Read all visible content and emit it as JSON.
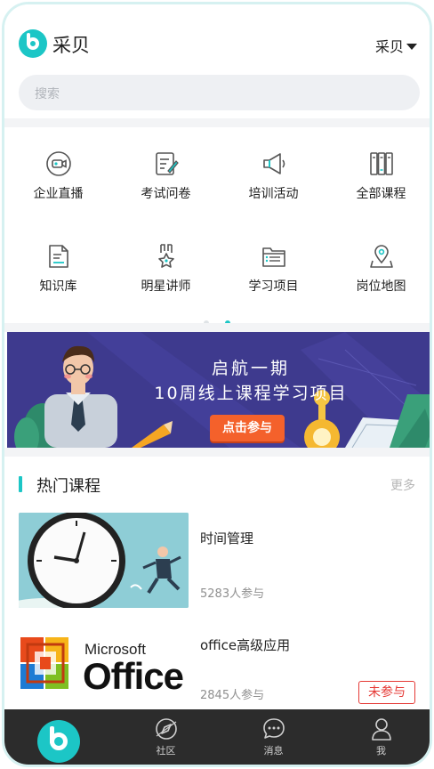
{
  "header": {
    "app_title": "采贝",
    "location": "采贝"
  },
  "search": {
    "placeholder": "搜索"
  },
  "grid": [
    {
      "label": "企业直播",
      "icon": "live-camera-icon"
    },
    {
      "label": "考试问卷",
      "icon": "exam-form-icon"
    },
    {
      "label": "培训活动",
      "icon": "megaphone-icon"
    },
    {
      "label": "全部课程",
      "icon": "books-icon"
    },
    {
      "label": "知识库",
      "icon": "document-icon"
    },
    {
      "label": "明星讲师",
      "icon": "star-medal-icon"
    },
    {
      "label": "学习项目",
      "icon": "folder-list-icon"
    },
    {
      "label": "岗位地图",
      "icon": "map-pin-icon"
    }
  ],
  "banner": {
    "line1": "启航一期",
    "line2": "10周线上课程学习项目",
    "button": "点击参与"
  },
  "hot_courses": {
    "title": "热门课程",
    "more": "更多",
    "items": [
      {
        "title": "时间管理",
        "count": "5283人参与",
        "status": ""
      },
      {
        "title": "office高级应用",
        "count": "2845人参与",
        "status": "未参与"
      }
    ],
    "office_logo": {
      "brand": "Microsoft",
      "product": "Office"
    }
  },
  "tabbar": [
    {
      "label": "社区",
      "icon": "compass-icon"
    },
    {
      "label": "消息",
      "icon": "chat-bubble-icon"
    },
    {
      "label": "我",
      "icon": "person-icon"
    }
  ],
  "colors": {
    "accent": "#1cc6c6",
    "banner_bg": "#3e3a8e",
    "banner_button": "#f4612b",
    "tabbar_bg": "#2c2c2c",
    "badge": "#e53935"
  }
}
